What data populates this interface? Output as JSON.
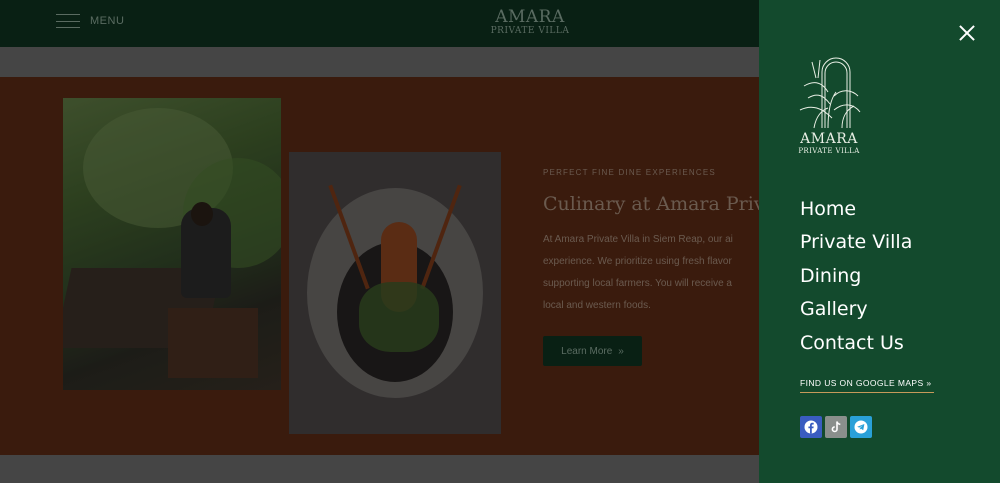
{
  "header": {
    "menu_label": "MENU",
    "logo_line1": "AMARA",
    "logo_line2": "PRIVATE VILLA"
  },
  "section": {
    "eyebrow": "PERFECT FINE DINE EXPERIENCES",
    "title": "Culinary at Amara Priva",
    "body_lines": [
      "At Amara Private Villa in Siem Reap, our ai",
      "experience. We prioritize using fresh flavor",
      "supporting local farmers. You will receive a",
      "local and western foods."
    ],
    "button_label": "Learn More",
    "button_arrow": "»"
  },
  "panel": {
    "close_icon": "close-icon",
    "logo_name": "AMARA",
    "logo_sub": "PRIVATE VILLA",
    "nav": [
      {
        "label": "Home"
      },
      {
        "label": "Private Villa"
      },
      {
        "label": "Dining"
      },
      {
        "label": "Gallery"
      },
      {
        "label": "Contact Us"
      }
    ],
    "maps_link": "FIND US ON GOOGLE MAPS »",
    "socials": [
      {
        "name": "facebook-icon",
        "color": "#3a5cc0"
      },
      {
        "name": "tiktok-icon",
        "color": "#8a8f8c"
      },
      {
        "name": "telegram-icon",
        "color": "#2aa0d8"
      }
    ]
  },
  "colors": {
    "header_bg": "#0e3220",
    "panel_bg": "#134a2d",
    "section_bg": "#5a2a15",
    "accent_underline": "#c79a5a"
  }
}
